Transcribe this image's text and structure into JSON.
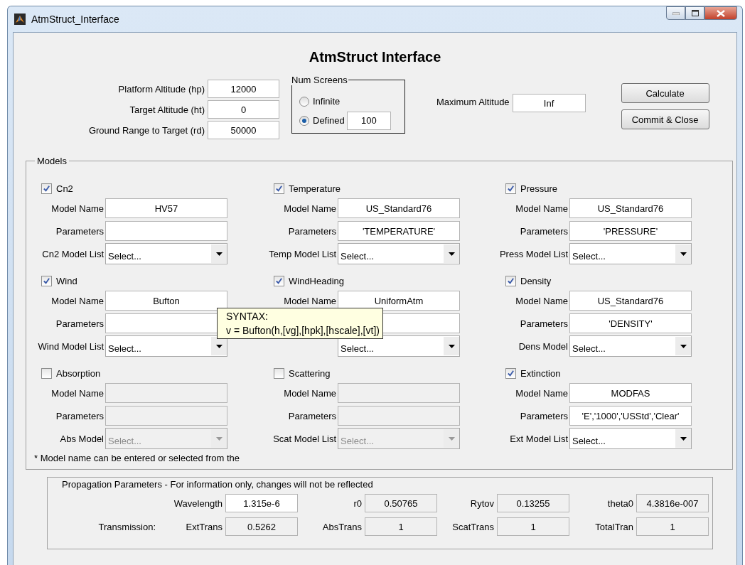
{
  "window": {
    "title": "AtmStruct_Interface"
  },
  "heading": "AtmStruct Interface",
  "inputs": [
    {
      "label": "Platform Altitude (hp)",
      "value": "12000"
    },
    {
      "label": "Target Altitude (ht)",
      "value": "0"
    },
    {
      "label": "Ground Range to Target (rd)",
      "value": "50000"
    }
  ],
  "num_screens": {
    "title": "Num Screens",
    "options": [
      {
        "label": "Infinite",
        "selected": false
      },
      {
        "label": "Defined",
        "selected": true,
        "value": "100"
      }
    ]
  },
  "max_altitude": {
    "label": "Maximum Altitude",
    "value": "Inf"
  },
  "buttons": [
    "Calculate",
    "Commit & Close"
  ],
  "models": {
    "title": "Models",
    "groups": [
      {
        "label": "Cn2",
        "checked": true,
        "name_label": "Model Name",
        "model_name": "HV57",
        "param_label": "Parameters",
        "list_label": "Cn2 Model List",
        "list_value": "Select..."
      },
      {
        "label": "Temperature",
        "checked": true,
        "name_label": "Model Name",
        "model_name": "US_Standard76",
        "param_label": "Parameters",
        "parameters": "'TEMPERATURE'",
        "list_label": "Temp Model List",
        "list_value": "Select..."
      },
      {
        "label": "Pressure",
        "checked": true,
        "name_label": "Model Name",
        "model_name": "US_Standard76",
        "param_label": "Parameters",
        "parameters": "'PRESSURE'",
        "list_label": "Press Model List",
        "list_value": "Select..."
      },
      {
        "label": "Wind",
        "checked": true,
        "name_label": "Model Name",
        "model_name": "Bufton",
        "param_label": "Parameters",
        "list_label": "Wind Model List",
        "list_value": "Select..."
      },
      {
        "label": "WindHeading",
        "checked": true,
        "name_label": "Model Name",
        "model_name": "UniformAtm",
        "list_value": "Select..."
      },
      {
        "label": "Density",
        "checked": true,
        "name_label": "Model Name",
        "model_name": "US_Standard76",
        "param_label": "Parameters",
        "parameters": "'DENSITY'",
        "list_label": "Dens Model",
        "list_value": "Select..."
      },
      {
        "label": "Absorption",
        "checked": false,
        "name_label": "Model Name",
        "param_label": "Parameters",
        "list_label": "Abs Model",
        "list_value": "Select..."
      },
      {
        "label": "Scattering",
        "checked": false,
        "name_label": "Model Name",
        "param_label": "Parameters",
        "list_label": "Scat Model List",
        "list_value": "Select..."
      },
      {
        "label": "Extinction",
        "checked": true,
        "name_label": "Model Name",
        "model_name": "MODFAS",
        "param_label": "Parameters",
        "parameters": "'E','1000','USStd','Clear'",
        "list_label": "Ext Model List",
        "list_value": "Select..."
      }
    ],
    "note": "* Model name can be entered or selected from the"
  },
  "tooltip": {
    "lines": [
      "SYNTAX:",
      "v = Bufton(h,[vg],[hpk],[hscale],[vt])"
    ]
  },
  "propagation": {
    "title": "Propagation Parameters - For information only, changes will not be reflected",
    "rows": [
      {
        "items": [
          {
            "label": "Wavelength",
            "value": "1.315e-6",
            "editable": true
          },
          {
            "label": "r0",
            "value": "0.50765",
            "editable": false
          },
          {
            "label": "Rytov",
            "value": "0.13255",
            "editable": false
          },
          {
            "label": "theta0",
            "value": "4.3816e-007",
            "editable": false
          }
        ]
      },
      {
        "label": "Transmission:",
        "items": [
          {
            "label": "ExtTrans",
            "value": "0.5262",
            "editable": false
          },
          {
            "label": "AbsTrans",
            "value": "1",
            "editable": false
          },
          {
            "label": "ScatTrans",
            "value": "1",
            "editable": false
          },
          {
            "label": "TotalTran",
            "value": "1",
            "editable": false
          }
        ]
      }
    ]
  }
}
